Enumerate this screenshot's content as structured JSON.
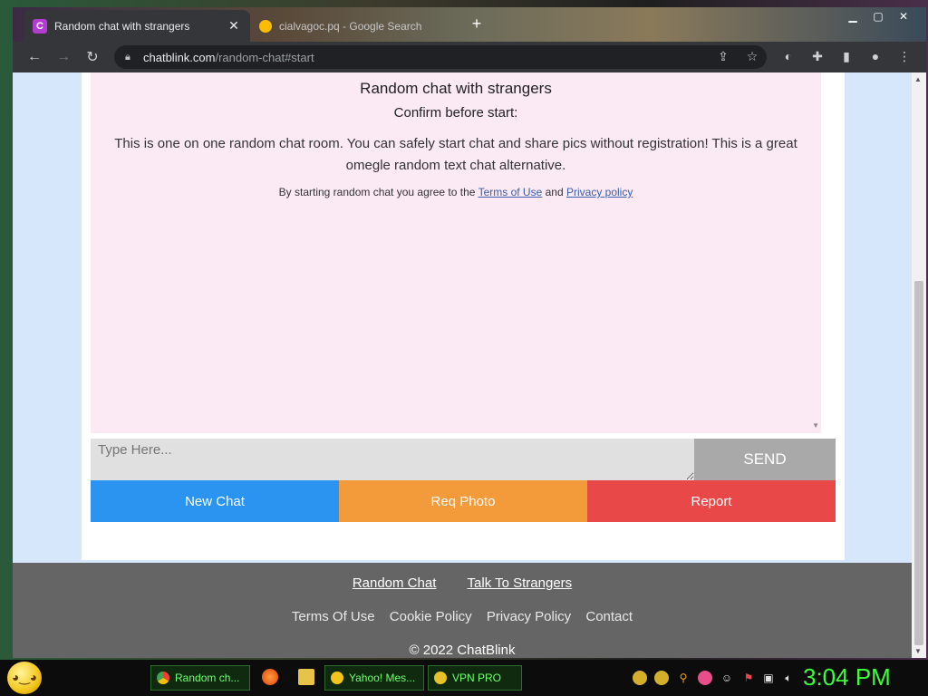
{
  "browser": {
    "active_tab": {
      "title": "Random chat with strangers",
      "favicon": "C"
    },
    "inactive_tab": {
      "title": "cialvagoc.pq - Google Search"
    },
    "new_tab_label": "+",
    "url_host": "chatblink.com",
    "url_path": "/random-chat#start"
  },
  "chat": {
    "heading": "Random chat with strangers",
    "confirm": "Confirm before start:",
    "description": "This is one on one random chat room. You can safely start chat and share pics without registration! This is a great omegle random text chat alternative.",
    "terms_prefix": "By starting random chat you agree to the",
    "terms_link": "Terms of Use",
    "terms_and": "and",
    "privacy_link": "Privacy policy"
  },
  "input": {
    "placeholder": "Type Here...",
    "send_label": "SEND"
  },
  "actions": {
    "new_chat": "New Chat",
    "req_photo": "Req Photo",
    "report": "Report"
  },
  "footer": {
    "main_links": [
      "Random Chat",
      "Talk To Strangers"
    ],
    "links": [
      "Terms Of Use",
      "Cookie Policy",
      "Privacy Policy",
      "Contact"
    ],
    "copyright": "© 2022 ChatBlink"
  },
  "taskbar": {
    "items": [
      {
        "label": "Random ch...",
        "icon": "chrome-icon"
      },
      {
        "label": "Yahoo! Mes...",
        "icon": "yahoo-icon"
      },
      {
        "label": "VPN PRO",
        "icon": "vpn-icon"
      }
    ],
    "clock": "3:04 PM"
  },
  "colors": {
    "new_chat": "#2b93f0",
    "req_photo": "#f39a3b",
    "report": "#e84848",
    "send": "#a9a9a9",
    "chat_bg": "#fbe9f3",
    "page_bg": "#d6e7fb",
    "footer_bg": "#656565",
    "clock": "#3cff3c"
  }
}
